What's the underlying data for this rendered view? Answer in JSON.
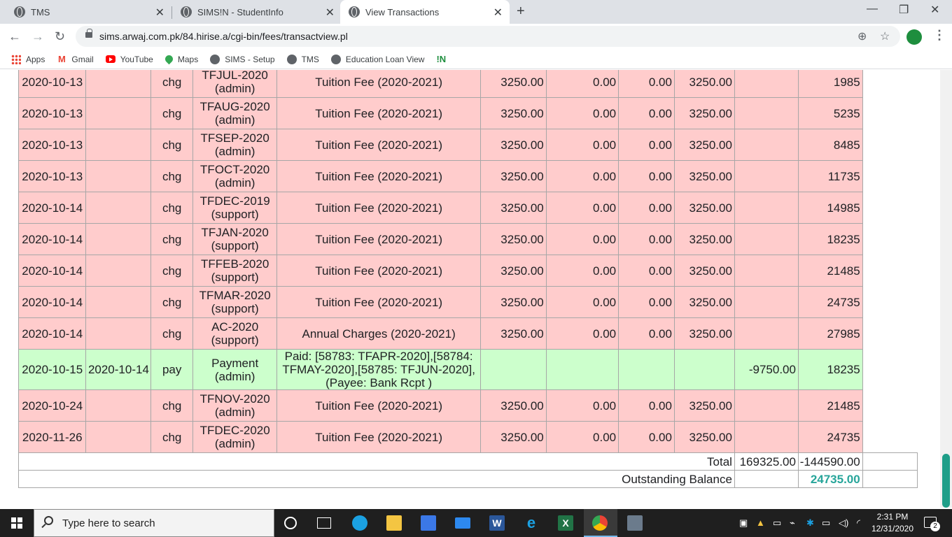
{
  "browser": {
    "tabs": [
      {
        "title": "TMS"
      },
      {
        "title": "SIMS!N - StudentInfo"
      },
      {
        "title": "View Transactions"
      }
    ],
    "url": "sims.arwaj.com.pk/84.hirise.a/cgi-bin/fees/transactview.pl",
    "bookmarks": [
      "Apps",
      "Gmail",
      "YouTube",
      "Maps",
      "SIMS - Setup",
      "TMS",
      "Education Loan View",
      "!N"
    ]
  },
  "transactions": [
    {
      "kind": "chg",
      "date": "2020-10-13",
      "date2": "",
      "type": "chg",
      "ref1": "TFJUL-2020",
      "ref2": "(admin)",
      "desc": "Tuition Fee (2020-2021)",
      "amount": "3250.00",
      "disc1": "0.00",
      "disc2": "0.00",
      "net": "3250.00",
      "paid": "",
      "balance": "1985"
    },
    {
      "kind": "chg",
      "date": "2020-10-13",
      "date2": "",
      "type": "chg",
      "ref1": "TFAUG-2020",
      "ref2": "(admin)",
      "desc": "Tuition Fee (2020-2021)",
      "amount": "3250.00",
      "disc1": "0.00",
      "disc2": "0.00",
      "net": "3250.00",
      "paid": "",
      "balance": "5235"
    },
    {
      "kind": "chg",
      "date": "2020-10-13",
      "date2": "",
      "type": "chg",
      "ref1": "TFSEP-2020",
      "ref2": "(admin)",
      "desc": "Tuition Fee (2020-2021)",
      "amount": "3250.00",
      "disc1": "0.00",
      "disc2": "0.00",
      "net": "3250.00",
      "paid": "",
      "balance": "8485"
    },
    {
      "kind": "chg",
      "date": "2020-10-13",
      "date2": "",
      "type": "chg",
      "ref1": "TFOCT-2020",
      "ref2": "(admin)",
      "desc": "Tuition Fee (2020-2021)",
      "amount": "3250.00",
      "disc1": "0.00",
      "disc2": "0.00",
      "net": "3250.00",
      "paid": "",
      "balance": "11735"
    },
    {
      "kind": "chg",
      "date": "2020-10-14",
      "date2": "",
      "type": "chg",
      "ref1": "TFDEC-2019",
      "ref2": "(support)",
      "desc": "Tuition Fee (2020-2021)",
      "amount": "3250.00",
      "disc1": "0.00",
      "disc2": "0.00",
      "net": "3250.00",
      "paid": "",
      "balance": "14985"
    },
    {
      "kind": "chg",
      "date": "2020-10-14",
      "date2": "",
      "type": "chg",
      "ref1": "TFJAN-2020",
      "ref2": "(support)",
      "desc": "Tuition Fee (2020-2021)",
      "amount": "3250.00",
      "disc1": "0.00",
      "disc2": "0.00",
      "net": "3250.00",
      "paid": "",
      "balance": "18235"
    },
    {
      "kind": "chg",
      "date": "2020-10-14",
      "date2": "",
      "type": "chg",
      "ref1": "TFFEB-2020",
      "ref2": "(support)",
      "desc": "Tuition Fee (2020-2021)",
      "amount": "3250.00",
      "disc1": "0.00",
      "disc2": "0.00",
      "net": "3250.00",
      "paid": "",
      "balance": "21485"
    },
    {
      "kind": "chg",
      "date": "2020-10-14",
      "date2": "",
      "type": "chg",
      "ref1": "TFMAR-2020",
      "ref2": "(support)",
      "desc": "Tuition Fee (2020-2021)",
      "amount": "3250.00",
      "disc1": "0.00",
      "disc2": "0.00",
      "net": "3250.00",
      "paid": "",
      "balance": "24735"
    },
    {
      "kind": "chg",
      "date": "2020-10-14",
      "date2": "",
      "type": "chg",
      "ref1": "AC-2020",
      "ref2": "(support)",
      "desc": "Annual Charges (2020-2021)",
      "amount": "3250.00",
      "disc1": "0.00",
      "disc2": "0.00",
      "net": "3250.00",
      "paid": "",
      "balance": "27985"
    },
    {
      "kind": "pay",
      "date": "2020-10-15",
      "date2": "2020-10-14",
      "type": "pay",
      "ref1": "Payment",
      "ref2": "(admin)",
      "desc": "Paid: [58783: TFAPR-2020],[58784: TFMAY-2020],[58785: TFJUN-2020], (Payee: Bank Rcpt )",
      "amount": "",
      "disc1": "",
      "disc2": "",
      "net": "",
      "paid": "-9750.00",
      "balance": "18235"
    },
    {
      "kind": "chg",
      "date": "2020-10-24",
      "date2": "",
      "type": "chg",
      "ref1": "TFNOV-2020",
      "ref2": "(admin)",
      "desc": "Tuition Fee (2020-2021)",
      "amount": "3250.00",
      "disc1": "0.00",
      "disc2": "0.00",
      "net": "3250.00",
      "paid": "",
      "balance": "21485"
    },
    {
      "kind": "chg",
      "date": "2020-11-26",
      "date2": "",
      "type": "chg",
      "ref1": "TFDEC-2020",
      "ref2": "(admin)",
      "desc": "Tuition Fee (2020-2021)",
      "amount": "3250.00",
      "disc1": "0.00",
      "disc2": "0.00",
      "net": "3250.00",
      "paid": "",
      "balance": "24735"
    }
  ],
  "totals": {
    "label": "Total",
    "net": "169325.00",
    "paid": "-144590.00",
    "outstanding_label": "Outstanding Balance",
    "outstanding": "24735.00"
  },
  "taskbar": {
    "search_placeholder": "Type here to search",
    "time": "2:31 PM",
    "date": "12/31/2020",
    "notifications": "2"
  }
}
